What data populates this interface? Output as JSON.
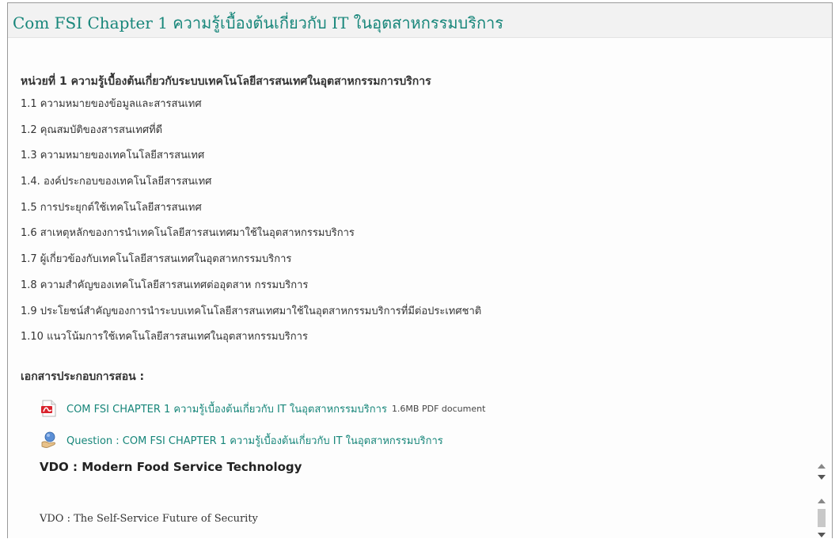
{
  "page": {
    "title": "Com FSI Chapter 1 ความรู้เบื้องต้นเกี่ยวกับ IT ในอุตสาหกรรมบริการ",
    "unit_heading": "หน่วยที่ 1 ความรู้เบื้องต้นเกี่ยวกับระบบเทคโนโลยีสารสนเทศในอุตสาหกรรมการบริการ",
    "topics": [
      "1.1 ความหมายของข้อมูลและสารสนเทศ",
      "1.2 คุณสมบัติของสารสนเทศที่ดี",
      "1.3 ความหมายของเทคโนโลยีสารสนเทศ",
      "1.4. องค์ประกอบของเทคโนโลยีสารสนเทศ",
      "1.5 การประยุกต์ใช้เทคโนโลยีสารสนเทศ",
      "1.6 สาเหตุหลักของการนำเทคโนโลยีสารสนเทศมาใช้ในอุตสาหกรรมบริการ",
      "1.7 ผู้เกี่ยวข้องกับเทคโนโลยีสารสนเทศในอุตสาหกรรมบริการ",
      "1.8  ความสำคัญของเทคโนโลยีสารสนเทศต่ออุตสาห กรรมบริการ",
      "1.9  ประโยชน์สำคัญของการนำระบบเทคโนโลยีสารสนเทศมาใช้ในอุตสาหกรรมบริการที่มีต่อประเทศชาติ",
      "1.10  แนวโน้มการใช้เทคโนโลยีสารสนเทศในอุตสาหกรรมบริการ"
    ],
    "docs_heading": "เอกสารประกอบการสอน :",
    "resources": [
      {
        "icon": "pdf-icon",
        "label": "COM FSI CHAPTER 1 ความรู้เบื้องต้นเกี่ยวกับ IT ในอุตสาหกรรมบริการ",
        "meta": "1.6MB PDF document"
      },
      {
        "icon": "quiz-icon",
        "label": "Question : COM FSI CHAPTER 1 ความรู้เบื้องต้นเกี่ยวกับ IT ในอุตสาหกรรมบริการ"
      }
    ],
    "vdo_title": "VDO : Modern Food Service Technology",
    "vdo_sub": "VDO : The Self-Service Future of Security"
  },
  "colors": {
    "link": "#17867a",
    "title_bar": "#f2f2f2",
    "pdf_red": "#d9232d"
  }
}
